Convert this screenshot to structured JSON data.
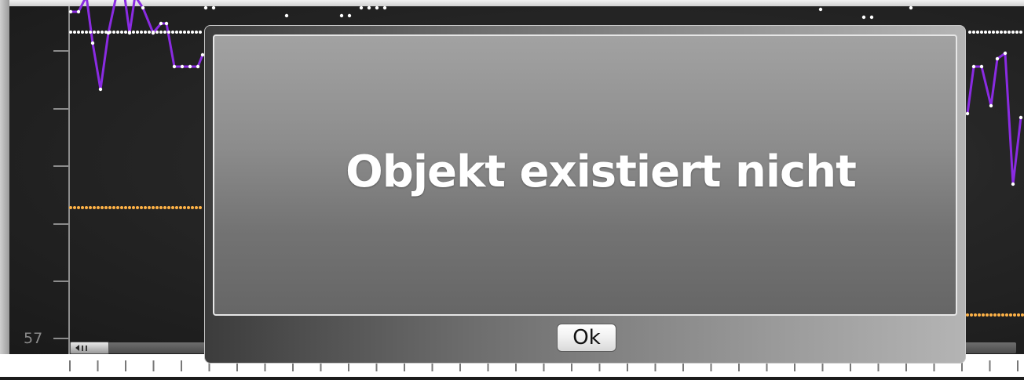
{
  "chart": {
    "y_tick_label": "57",
    "colors": {
      "purple_series": "#8a2be2",
      "white_series": "#ffffff",
      "orange_series": "#ffb347",
      "axis": "#8c8c8c",
      "tick": "#777777"
    }
  },
  "dialog": {
    "message": "Objekt existiert nicht",
    "ok_label": "Ok"
  },
  "icons": {
    "scroll_left": "triangle-left-icon",
    "scroll_grip": "grip-icon"
  }
}
